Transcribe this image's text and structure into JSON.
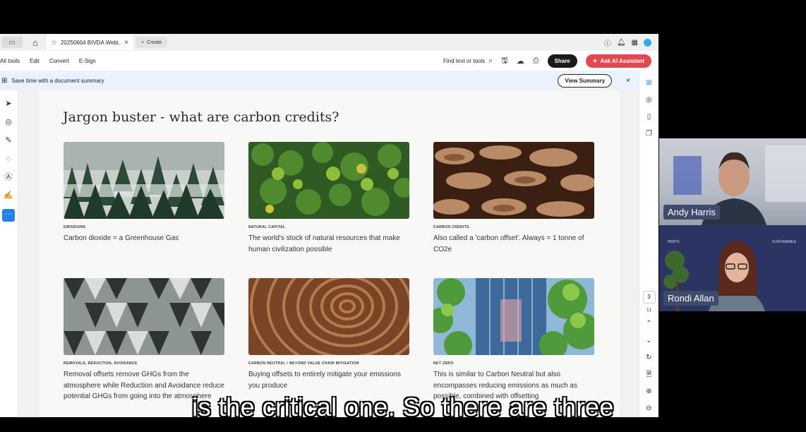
{
  "tabbar": {
    "doc_tab_title": "20250604 BIVDA Webi...",
    "create_label": "Create"
  },
  "toolbar": {
    "menu": [
      "All tools",
      "Edit",
      "Convert",
      "E-Sign"
    ],
    "find_label": "Find text or tools",
    "share_label": "Share",
    "ai_label": "Ask AI Assistant"
  },
  "summary_bar": {
    "text": "Save time with a document summary",
    "button_label": "View Summary"
  },
  "page": {
    "title": "Jargon buster - what are carbon credits?",
    "cards": [
      {
        "tag": "EMISSIONS",
        "desc": "Carbon dioxide = a Greenhouse Gas"
      },
      {
        "tag": "NATURAL CAPITAL",
        "desc": "The world's stock of natural resources that make human civilization possible"
      },
      {
        "tag": "CARBON CREDITS",
        "desc": "Also called a 'carbon offset'. Always = 1 tonne of CO2e"
      },
      {
        "tag": "REMOVALS, REDUCTION, AVOIDANCE",
        "desc": "Removal offsets remove GHGs from the atmosphere while Reduction and Avoidance reduce potential GHGs from going into the atmosphere"
      },
      {
        "tag": "CARBON NEUTRAL / BEYOND VALUE CHAIN MITIGATION",
        "desc": "Buying offsets to entirely mitigate your emissions you produce"
      },
      {
        "tag": "NET ZERO",
        "desc": "This is similar to Carbon Neutral but also encompasses reducing emissions as much as possible, combined with offsetting"
      }
    ]
  },
  "right_rail": {
    "page_number": "3",
    "page_total": "11"
  },
  "video": {
    "participant_1": "Andy Harris",
    "participant_2": "Rondi Allan"
  },
  "caption": "is the critical one. So there are three",
  "colors": {
    "share_bg": "#1a1a1a",
    "ai_bg": "#e34850",
    "summary_bg": "#eaf3fd",
    "nameplate_bg": "#3f4b6a"
  }
}
